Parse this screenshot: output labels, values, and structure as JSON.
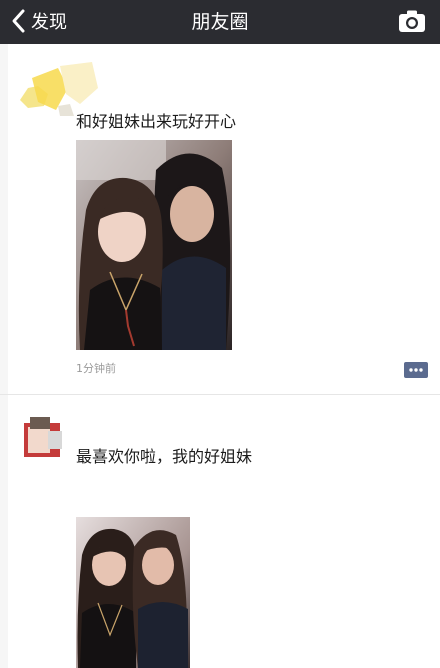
{
  "navbar": {
    "back_label": "发现",
    "title": "朋友圈",
    "icons": {
      "back": "chevron-left-icon",
      "camera": "camera-icon"
    }
  },
  "posts": [
    {
      "text": "和好姐妹出来玩好开心",
      "time": "1分钟前",
      "photo": "selfie-photo-two-women"
    },
    {
      "text": "最喜欢你啦，我的好姐妹",
      "photo": "selfie-photo-two-women"
    }
  ],
  "colors": {
    "navbar": "#2b2c31",
    "comment_icon": "#5b6b8f"
  }
}
